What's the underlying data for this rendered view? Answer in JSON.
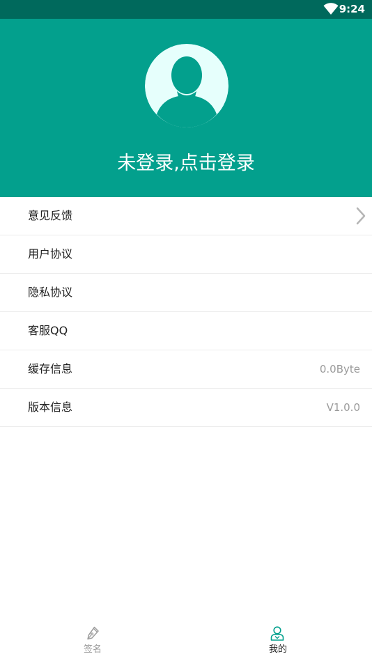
{
  "status_bar": {
    "time": "9:24",
    "icons": [
      "wifi-icon"
    ]
  },
  "header": {
    "login_prompt": "未登录,点击登录",
    "avatar_icon": "user-avatar-icon",
    "background_color": "#03A08D"
  },
  "menu": {
    "items": [
      {
        "label": "意见反馈",
        "value": "",
        "icon": "chevron-right-icon"
      },
      {
        "label": "用户协议",
        "value": ""
      },
      {
        "label": "隐私协议",
        "value": ""
      },
      {
        "label": "客服QQ",
        "value": ""
      },
      {
        "label": "缓存信息",
        "value": "0.0Byte"
      },
      {
        "label": "版本信息",
        "value": "V1.0.0"
      }
    ]
  },
  "bottom_nav": {
    "items": [
      {
        "label": "签名",
        "icon": "pen-icon",
        "active": false
      },
      {
        "label": "我的",
        "icon": "user-icon",
        "active": true
      }
    ],
    "active_color": "#03A08D"
  }
}
